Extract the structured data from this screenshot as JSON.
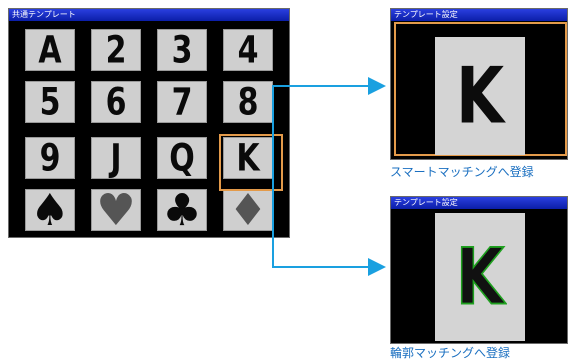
{
  "left_window": {
    "title": "共通テンプレート",
    "cards": [
      {
        "label": "A",
        "kind": "text"
      },
      {
        "label": "2",
        "kind": "text"
      },
      {
        "label": "3",
        "kind": "text"
      },
      {
        "label": "4",
        "kind": "text"
      },
      {
        "label": "5",
        "kind": "text"
      },
      {
        "label": "6",
        "kind": "text"
      },
      {
        "label": "7",
        "kind": "text"
      },
      {
        "label": "8",
        "kind": "text"
      },
      {
        "label": "9",
        "kind": "text"
      },
      {
        "label": "J",
        "kind": "text"
      },
      {
        "label": "Q",
        "kind": "text"
      },
      {
        "label": "K",
        "kind": "text"
      },
      {
        "label": "",
        "kind": "spade-icon"
      },
      {
        "label": "",
        "kind": "heart-icon"
      },
      {
        "label": "",
        "kind": "club-icon"
      },
      {
        "label": "",
        "kind": "diamond-icon"
      }
    ],
    "selected_card": "K"
  },
  "top_right_window": {
    "title": "テンプレート設定",
    "card_label": "K",
    "caption": "スマートマッチングへ登録"
  },
  "bottom_right_window": {
    "title": "テンプレート設定",
    "card_label": "K",
    "caption": "輪郭マッチングへ登録"
  },
  "colors": {
    "arrow": "#1aa0e0",
    "selection": "#e39a4a",
    "contour": "#1fa01f",
    "caption": "#1a6fc0",
    "titlebar": "#0b1ea8"
  }
}
